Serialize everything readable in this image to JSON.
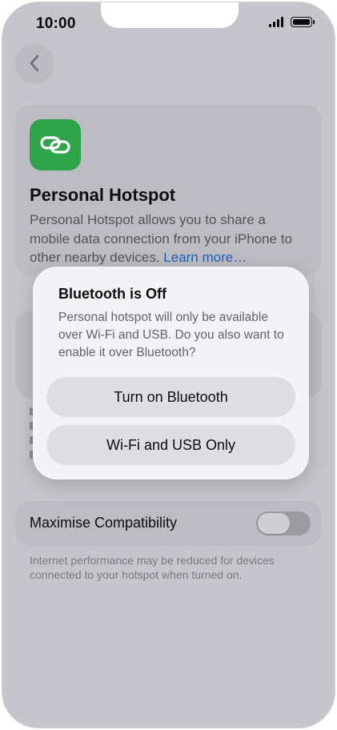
{
  "status_bar": {
    "time": "10:00"
  },
  "header": {
    "back_icon": "chevron-left-icon"
  },
  "hotspot_card": {
    "icon": "link-icon",
    "icon_color": "#2fa34a",
    "title": "Personal Hotspot",
    "description": "Personal Hotspot allows you to share a mobile data connection from your iPhone to other nearby devices.",
    "learn_more": "Learn more…",
    "link_color": "#1f5fb8"
  },
  "compatibility": {
    "label": "Maximise Compatibility",
    "toggle_on": false,
    "footer": "Internet performance may be reduced for devices connected to your hotspot when turned on."
  },
  "alert": {
    "title": "Bluetooth is Off",
    "message": "Personal hotspot will only be available over Wi-Fi and USB. Do you also want to enable it over Bluetooth?",
    "primary_button": "Turn on Bluetooth",
    "secondary_button": "Wi-Fi and USB Only"
  }
}
